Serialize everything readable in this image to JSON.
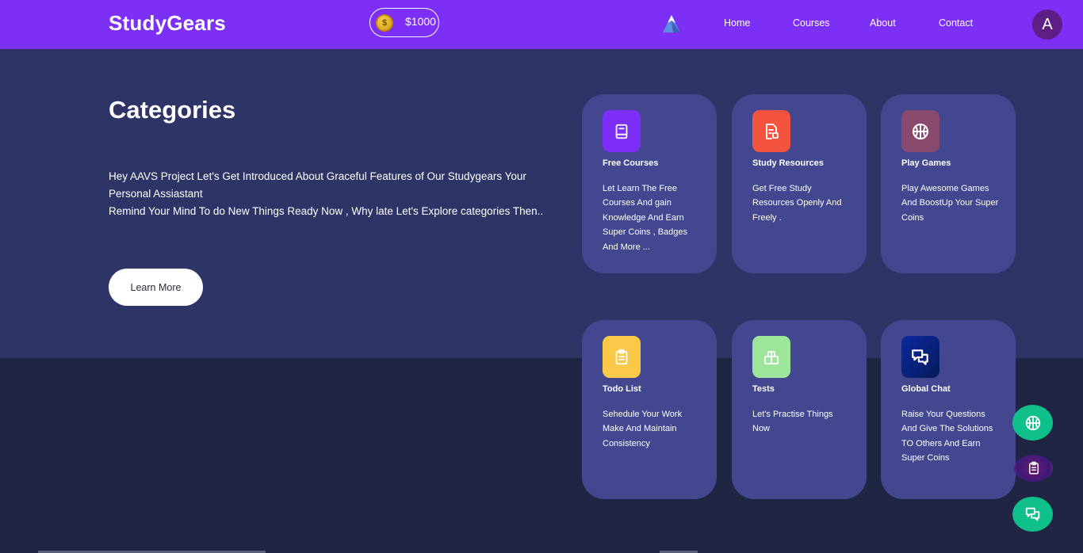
{
  "header": {
    "brand": "StudyGears",
    "coins": "$1000",
    "coin_symbol": "$",
    "nav": [
      "Home",
      "Courses",
      "About",
      "Contact"
    ],
    "avatar_initial": "A",
    "accent": "#7c2ff5"
  },
  "hero": {
    "title": "Categories",
    "description_line1": "Hey AAVS Project Let's Get Introduced About Graceful Features of Our Studygears Your Personal Assiastant",
    "description_line2": "Remind Your Mind To do New Things Ready Now , Why late Let's Explore categories Then..",
    "cta_label": "Learn More"
  },
  "cards": [
    {
      "title": "Free Courses",
      "text": "Let Learn The Free Courses And gain Knowledge And Earn Super Coins , Badges And More ...",
      "icon": "book-icon",
      "color": "#7b2ff7"
    },
    {
      "title": "Study Resources",
      "text": "Get Free Study Resources Openly And Freely .",
      "icon": "document-icon",
      "color": "#f4543f"
    },
    {
      "title": "Play Games",
      "text": "Play Awesome Games And BoostUp Your Super Coins",
      "icon": "basketball-icon",
      "color": "#8a4a6f"
    },
    {
      "title": "Todo List",
      "text": "Sehedule Your Work Make And Maintain Consistency",
      "icon": "clipboard-icon",
      "color": "#fbc94a"
    },
    {
      "title": "Tests",
      "text": "Let's Practise Things Now",
      "icon": "test-icon",
      "color": "#9de59b"
    },
    {
      "title": "Global Chat",
      "text": "Raise Your Questions And Give The Solutions TO Others And Earn Super Coins",
      "icon": "chat-icon",
      "color": "#0a2a9e"
    }
  ],
  "floating_buttons": [
    {
      "icon": "basketball-icon",
      "color": "#10c08a"
    },
    {
      "icon": "clipboard-icon",
      "color": "#6a1a6e"
    },
    {
      "icon": "chat-icon",
      "color": "#10c08a"
    }
  ]
}
